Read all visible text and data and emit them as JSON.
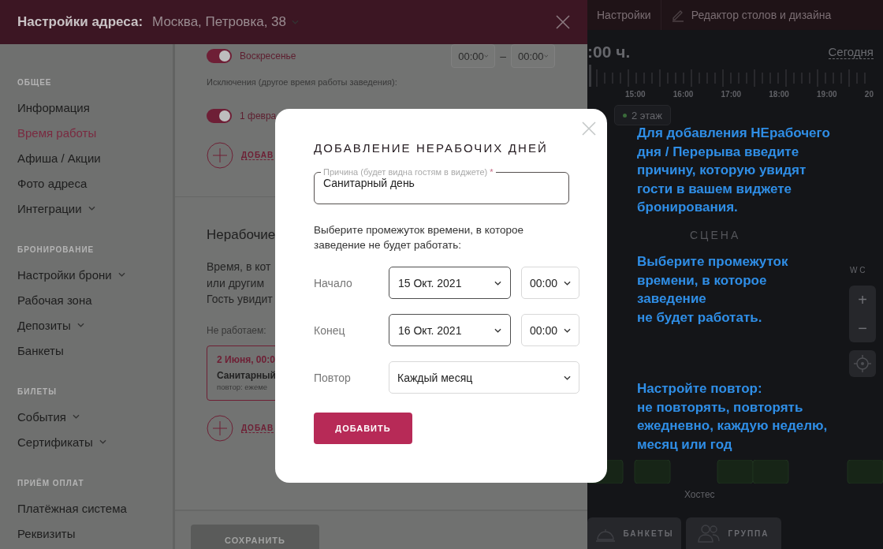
{
  "drawer": {
    "title": "Настройки адреса:",
    "address": "Москва, Петровка, 38",
    "sidebar": [
      {
        "heading": "ОБЩЕЕ",
        "items": [
          {
            "label": "Информация",
            "selected": false,
            "expandable": false
          },
          {
            "label": "Время работы",
            "selected": true,
            "expandable": false
          },
          {
            "label": "Афиша / Акции",
            "selected": false,
            "expandable": false
          },
          {
            "label": "Фото адреса",
            "selected": false,
            "expandable": false
          },
          {
            "label": "Интеграции",
            "selected": false,
            "expandable": true
          }
        ]
      },
      {
        "heading": "БРОНИРОВАНИЕ",
        "items": [
          {
            "label": "Настройки брони",
            "selected": false,
            "expandable": true
          },
          {
            "label": "Рабочая зона",
            "selected": false,
            "expandable": false
          },
          {
            "label": "Депозиты",
            "selected": false,
            "expandable": true
          },
          {
            "label": "Банкеты",
            "selected": false,
            "expandable": false
          }
        ]
      },
      {
        "heading": "БИЛЕТЫ",
        "items": [
          {
            "label": "События",
            "selected": false,
            "expandable": true
          },
          {
            "label": "Сертификаты",
            "selected": false,
            "expandable": true
          }
        ]
      },
      {
        "heading": "ПРИЁМ ОПЛАТ",
        "items": [
          {
            "label": "Платёжная система",
            "selected": false,
            "expandable": false
          },
          {
            "label": "Реквизиты",
            "selected": false,
            "expandable": false
          }
        ]
      }
    ],
    "schedule": {
      "day": {
        "label": "Воскресенье",
        "on": true,
        "from": "00:00",
        "dash": "–",
        "to": "00:00"
      },
      "exceptions_label": "Исключения (другое время работы заведения):",
      "exception": {
        "label": "1 февра",
        "on": true
      },
      "add_label": "ДОБАВ"
    },
    "non_working": {
      "title": "Нерабочие",
      "description": [
        "Время, в кот",
        "или другим",
        "Гость увидит"
      ],
      "list_label": "Не работаем:",
      "card": {
        "date": "2 Июня, 00:0",
        "reason": "Санитарный",
        "repeat": "повтор: ежеме"
      },
      "add_label": "ДОБАВ"
    },
    "save_button": {
      "label": "СОХРАНИТЬ",
      "disabled": true
    }
  },
  "app": {
    "toolbar": [
      "Настройки",
      "Редактор столов и дизайна"
    ],
    "time": ":00 ч.",
    "today_link": "Сегодня",
    "timeline_labels": [
      "15:00",
      "16:00",
      "17:00",
      "18:00",
      "19:00",
      "20"
    ],
    "floor_chip": "2 этаж",
    "stage_label": "СЦЕНА",
    "wc_label": "W C",
    "hostess_label": "Хостес",
    "zoom_in": "+",
    "zoom_out": "−",
    "bottom_buttons": [
      {
        "kind": "banquet",
        "label": "БАНКЕТЫ"
      },
      {
        "kind": "group",
        "label": "ГРУППА"
      }
    ]
  },
  "modal": {
    "title": "ДОБАВЛЕНИЕ НЕРАБОЧИХ ДНЕЙ",
    "reason": {
      "label": "Причина (будет видна гостям в виджете)",
      "required_mark": "*",
      "value": "Санитарный день"
    },
    "prompt": "Выберите промежуток времени, в которое заведение не будет работать:",
    "rows": [
      {
        "kind": "range",
        "label": "Начало",
        "date": "15 Окт. 2021",
        "time": "00:00"
      },
      {
        "kind": "range",
        "label": "Конец",
        "date": "16 Окт. 2021",
        "time": "00:00"
      },
      {
        "kind": "repeat",
        "label": "Повтор",
        "value": "Каждый месяц"
      }
    ],
    "submit": "ДОБАВИТЬ"
  },
  "hints": [
    {
      "lines": [
        "Для добавления НЕрабочего",
        "дня / Перерыва введите",
        "причину, которую увидят",
        "гости в вашем виджете",
        "бронирования."
      ]
    },
    {
      "lines": [
        "Выберите промежуток",
        "времени, в которое",
        "заведение",
        "не будет работать."
      ]
    },
    {
      "lines": [
        "Настройте повтор:",
        "не повторять, повторять",
        "ежедневно, каждую неделю,",
        "месяц или год"
      ]
    }
  ]
}
